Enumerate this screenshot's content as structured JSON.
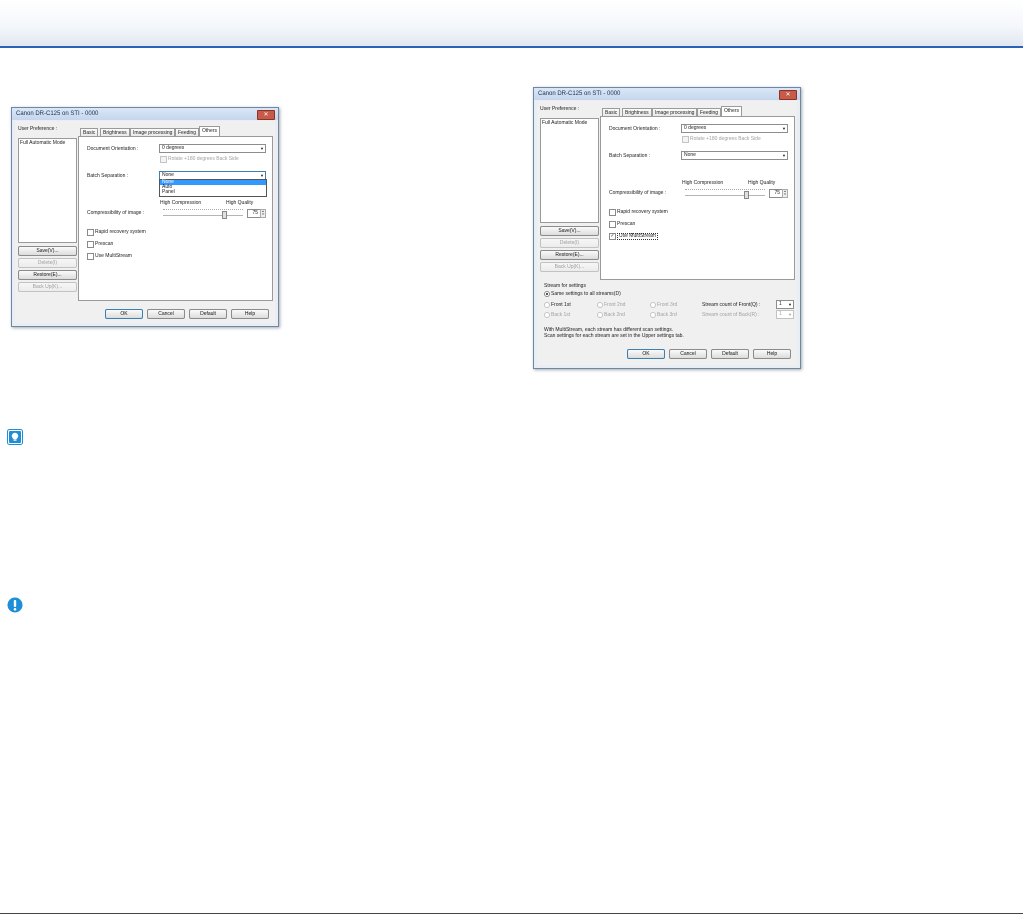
{
  "dialog_left": {
    "title": "Canon DR-C125 on STI - 0000",
    "user_preference_label": "User Preference :",
    "preferences": [
      "Full Automatic Mode"
    ],
    "side_buttons": [
      "Save(V)...",
      "Delete(I)",
      "Restore(E)...",
      "Back Up(K)..."
    ],
    "tabs": [
      "Basic",
      "Brightness",
      "Image processing",
      "Feeding",
      "Others"
    ],
    "active_tab": "Others",
    "document_orientation_label": "Document Orientation :",
    "document_orientation_value": "0 degrees",
    "rotate_back_label": "Rotate +180 degrees Back Side",
    "batch_separation_label": "Batch Separation :",
    "batch_separation_value": "None",
    "batch_options": [
      "None",
      "Auto",
      "Panel"
    ],
    "high_compression_label": "High Compression",
    "high_quality_label": "High Quality",
    "compressibility_label": "Compressibility of image :",
    "compressibility_value": "75",
    "rapid_recovery_label": "Rapid recovery system",
    "prescan_label": "Prescan",
    "use_multistream_label": "Use MultiStream",
    "footer_buttons": [
      "OK",
      "Cancel",
      "Default",
      "Help"
    ]
  },
  "dialog_right": {
    "title": "Canon DR-C125 on STI - 0000",
    "user_preference_label": "User Preference :",
    "preferences": [
      "Full Automatic Mode"
    ],
    "side_buttons": [
      "Save(V)...",
      "Delete(I)",
      "Restore(E)...",
      "Back Up(K)..."
    ],
    "tabs": [
      "Basic",
      "Brightness",
      "Image processing",
      "Feeding",
      "Others"
    ],
    "active_tab": "Others",
    "document_orientation_label": "Document Orientation :",
    "document_orientation_value": "0 degrees",
    "rotate_back_label": "Rotate +180 degrees Back Side",
    "batch_separation_label": "Batch Separation :",
    "batch_separation_value": "None",
    "high_compression_label": "High Compression",
    "high_quality_label": "High Quality",
    "compressibility_label": "Compressibility of image :",
    "compressibility_value": "75",
    "rapid_recovery_label": "Rapid recovery system",
    "prescan_label": "Prescan",
    "use_multistream_label": "Use MultiStream",
    "use_multistream_checked": true,
    "stream_settings_label": "Stream for settings",
    "same_settings_label": "Same settings to all streams(D)",
    "front_1st": "Front 1st",
    "front_2nd": "Front 2nd",
    "front_3rd": "Front 3rd",
    "back_1st": "Back 1st",
    "back_2nd": "Back 2nd",
    "back_3rd": "Back 3rd",
    "stream_count_front_label": "Stream count of Front(Q) :",
    "stream_count_front_value": "1",
    "stream_count_back_label": "Stream count of Back(R) :",
    "stream_count_back_value": "1",
    "note_line1": "With MultiStream, each stream has different scan settings.",
    "note_line2": "Scan settings for each stream are set in the Upper settings tab.",
    "footer_buttons": [
      "OK",
      "Cancel",
      "Default",
      "Help"
    ]
  },
  "icons": {
    "hint_icon": "lightbulb-icon",
    "important_icon": "exclamation-icon"
  },
  "colors": {
    "header_rule": "#2a62b9",
    "selection": "#3399ff",
    "important": "#1e8fd6"
  }
}
